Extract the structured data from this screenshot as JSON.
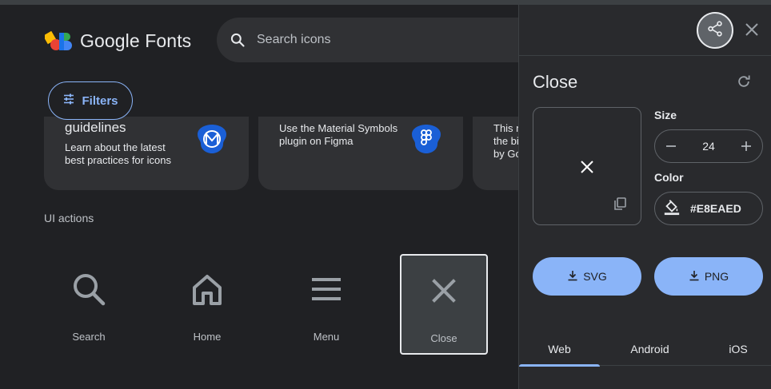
{
  "header": {
    "app_title": "Google Fonts",
    "search_placeholder": "Search icons"
  },
  "filters": {
    "label": "Filters"
  },
  "cards": [
    {
      "title": "guidelines",
      "desc_line1": "Learn about the latest",
      "desc_line2": "best practices for icons"
    },
    {
      "desc_line1": "Use the Material Symbols",
      "desc_line2": "plugin on Figma"
    },
    {
      "desc_line1": "This n",
      "desc_line2": "the bi",
      "desc_line3": "by Go"
    }
  ],
  "section": {
    "label": "UI actions"
  },
  "icons": [
    {
      "label": "Search",
      "icon": "search-icon"
    },
    {
      "label": "Home",
      "icon": "home-icon"
    },
    {
      "label": "Menu",
      "icon": "menu-icon"
    },
    {
      "label": "Close",
      "icon": "close-icon",
      "selected": true
    }
  ],
  "panel": {
    "title": "Close",
    "size_label": "Size",
    "size_value": "24",
    "color_label": "Color",
    "color_value": "#E8EAED",
    "download_svg": "SVG",
    "download_png": "PNG",
    "tabs": [
      "Web",
      "Android",
      "iOS"
    ],
    "active_tab": "Web"
  },
  "colors": {
    "accent": "#8ab4f8",
    "background": "#202124",
    "panel": "#292a2d",
    "text": "#e8eaed"
  }
}
